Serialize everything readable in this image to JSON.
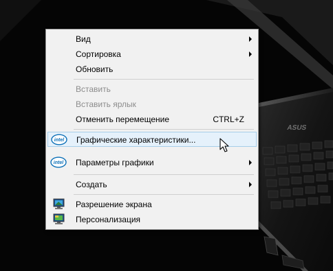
{
  "menu": {
    "items": [
      {
        "label": "Вид",
        "submenu": true
      },
      {
        "label": "Сортировка",
        "submenu": true
      },
      {
        "label": "Обновить"
      },
      {
        "label": "Вставить",
        "disabled": true
      },
      {
        "label": "Вставить ярлык",
        "disabled": true
      },
      {
        "label": "Отменить перемещение",
        "shortcut": "CTRL+Z"
      },
      {
        "label": "Графические характеристики...",
        "icon": "intel-icon",
        "highlighted": true
      },
      {
        "label": "Параметры графики",
        "icon": "intel-icon",
        "submenu": true
      },
      {
        "label": "Создать",
        "submenu": true
      },
      {
        "label": "Разрешение экрана",
        "icon": "display-resolution-icon"
      },
      {
        "label": "Персонализация",
        "icon": "personalization-icon"
      }
    ]
  },
  "wallpaper": {
    "logo_text": "ASUS"
  },
  "colors": {
    "menu_background": "#f1f1f1",
    "highlight_background": "#e5f1fb",
    "highlight_border": "#a6cde9",
    "disabled_text": "#8c8c8c",
    "intel_blue": "#0a6fb7"
  }
}
